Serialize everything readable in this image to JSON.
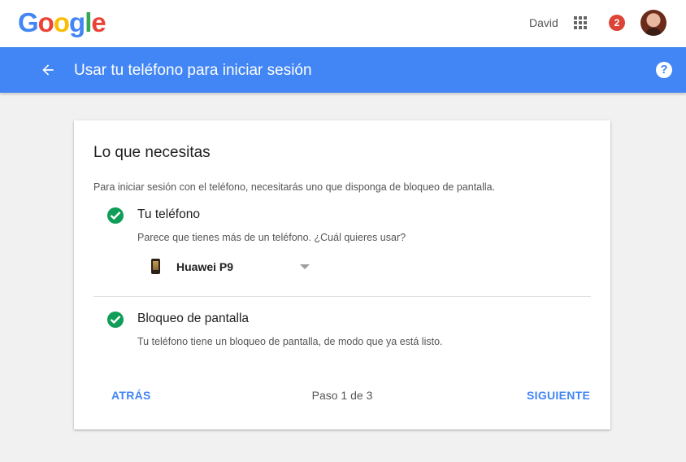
{
  "header": {
    "logo_letters": [
      {
        "char": "G",
        "color": "#4285f4"
      },
      {
        "char": "o",
        "color": "#ea4335"
      },
      {
        "char": "o",
        "color": "#fbbc05"
      },
      {
        "char": "g",
        "color": "#4285f4"
      },
      {
        "char": "l",
        "color": "#34a853"
      },
      {
        "char": "e",
        "color": "#ea4335"
      }
    ],
    "user_name": "David",
    "apps_icon": "apps-grid-icon",
    "notification_count": "2",
    "avatar_icon": "avatar"
  },
  "bar": {
    "back_icon": "arrow-back-icon",
    "title": "Usar tu teléfono para iniciar sesión",
    "help_icon": "help-icon",
    "help_glyph": "?",
    "color": "#4285f4"
  },
  "card": {
    "title": "Lo que necesitas",
    "intro": "Para iniciar sesión con el teléfono, necesitarás uno que disponga de bloqueo de pantalla.",
    "requirements": [
      {
        "title": "Tu teléfono",
        "description": "Parece que tienes más de un teléfono. ¿Cuál quieres usar?",
        "status_icon": "check-circle-icon"
      },
      {
        "title": "Bloqueo de pantalla",
        "description": "Tu teléfono tiene un bloqueo de pantalla, de modo que ya está listo.",
        "status_icon": "check-circle-icon"
      }
    ],
    "device_select": {
      "selected": "Huawei P9",
      "icon": "phone-icon"
    },
    "footer": {
      "back_label": "ATRÁS",
      "step_label": "Paso 1 de 3",
      "next_label": "SIGUIENTE"
    }
  },
  "colors": {
    "accent": "#4285f4",
    "success": "#0f9d58",
    "badge": "#db4437"
  }
}
